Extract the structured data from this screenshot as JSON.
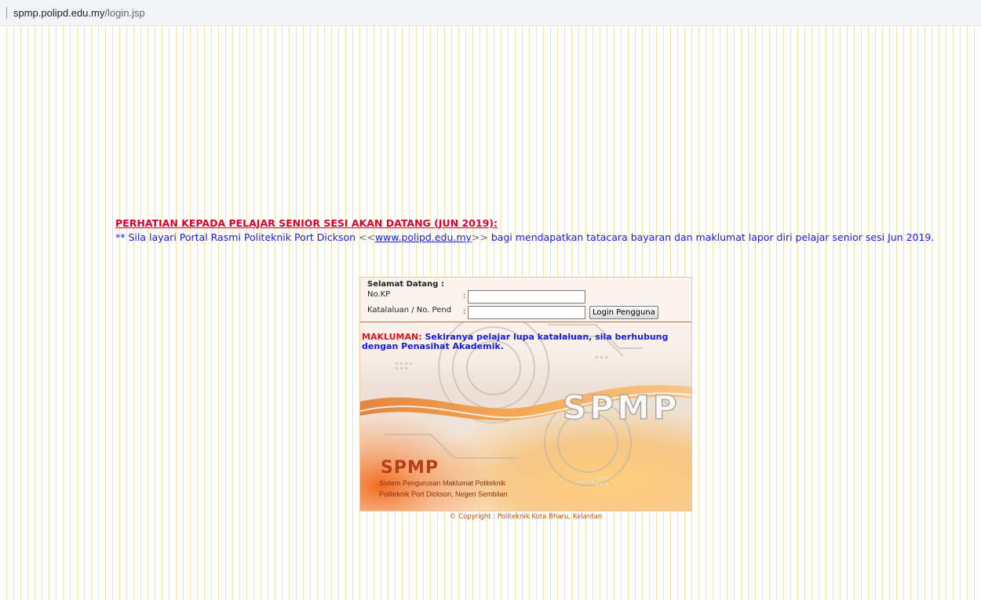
{
  "browser": {
    "url_host": "spmp.polipd.edu.my",
    "url_path": "/login.jsp"
  },
  "notice": {
    "title": "PERHATIAN KEPADA PELAJAR SENIOR SESI AKAN DATANG (JUN 2019):",
    "body_prefix": "** Sila layari Portal Rasmi Politeknik Port Dickson ",
    "link_open": "<<",
    "link_text": "www.polipd.edu.my",
    "link_close": ">>",
    "body_suffix": " bagi mendapatkan tatacara bayaran dan maklumat lapor diri pelajar senior sesi Jun 2019."
  },
  "login": {
    "welcome": "Selamat Datang :",
    "kp_label": "No.KP",
    "password_label": "Katalaluan / No. Pend",
    "colon": ":",
    "kp_value": "",
    "password_value": "",
    "button_label": "Login Pengguna"
  },
  "makluman": {
    "label": "MAKLUMAN:",
    "text": " Sekiranya pelajar lupa katalaluan, sila berhubung dengan Penasihat Akademik."
  },
  "banner": {
    "logo_big": "SPMP",
    "logo_small": "SPMP",
    "line1": "Sistem Pengurusan Maklumat Politeknik",
    "line2": "Politeknik Port Dickson, Negeri Sembilan"
  },
  "copyright": "© Copyright : Politeknik Kota Bharu, Kelantan",
  "colors": {
    "stripe": "#f4e2ad",
    "notice_title": "#d6002e",
    "notice_body": "#1a1ae0",
    "accent_orange": "#c9682c"
  }
}
